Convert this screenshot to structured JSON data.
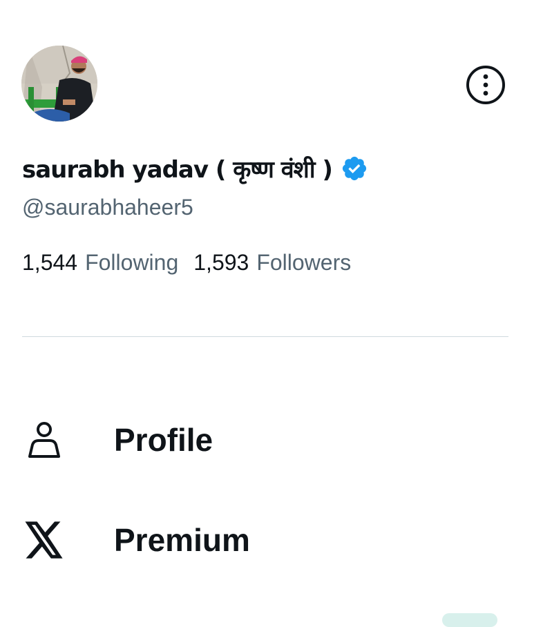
{
  "profile": {
    "display_name": "saurabh yadav ( कृष्ण वंशी )",
    "handle": "@saurabhaheer5",
    "verified": true,
    "verified_color": "#1d9bf0"
  },
  "stats": {
    "following_count": "1,544",
    "following_label": "Following",
    "followers_count": "1,593",
    "followers_label": "Followers"
  },
  "menu": {
    "items": [
      {
        "icon": "person-icon",
        "label": "Profile"
      },
      {
        "icon": "x-logo-icon",
        "label": "Premium"
      }
    ]
  },
  "header": {
    "more_icon": "more-options-icon"
  },
  "colors": {
    "text_primary": "#0f1419",
    "text_secondary": "#536471",
    "divider": "#cfd9de",
    "background": "#ffffff"
  }
}
